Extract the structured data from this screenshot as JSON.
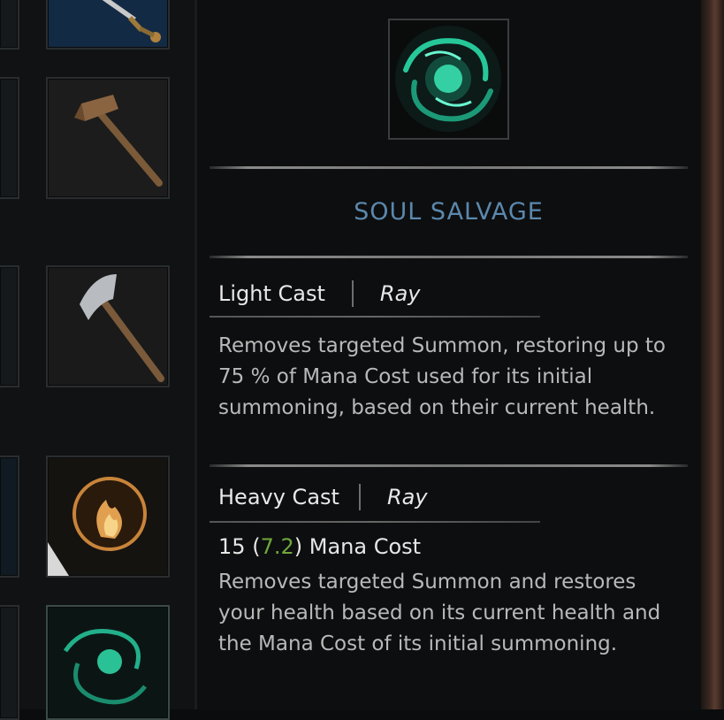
{
  "skill": {
    "icon": "soul-salvage-vortex-icon",
    "title": "SOUL SALVAGE"
  },
  "light_cast": {
    "label": "Light Cast",
    "type": "Ray",
    "description": "Removes targeted Summon, restoring up to 75 % of Mana Cost used for its initial summoning, based on their current health."
  },
  "heavy_cast": {
    "label": "Heavy Cast",
    "type": "Ray",
    "mana_value": "15",
    "mana_open": "(",
    "mana_reduced": "7.2",
    "mana_close": ")",
    "mana_label": "Mana Cost",
    "description": "Removes targeted Summon and restores your health based on its current health and the Mana Cost of its initial summoning."
  },
  "inventory": {
    "items": [
      "sword-icon",
      "hammer-icon",
      "axe-icon",
      "fire-orb-icon",
      "soul-salvage-vortex-icon"
    ]
  },
  "colors": {
    "title": "#5b88ad",
    "reduced_mana": "#6ea83c",
    "vortex": "#2fd4a4"
  }
}
